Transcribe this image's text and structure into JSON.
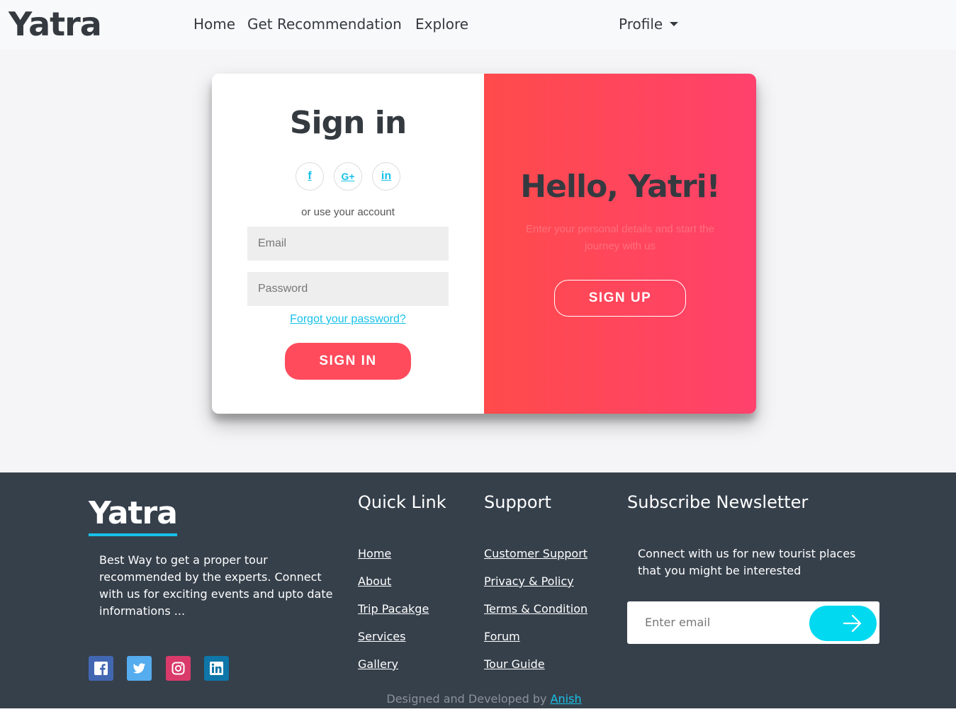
{
  "navbar": {
    "brand": "Yatra",
    "links": {
      "home": "Home",
      "recommendation": "Get Recommendation",
      "explore": "Explore"
    },
    "profile": "Profile"
  },
  "signin": {
    "title": "Sign in",
    "social_icons": [
      "facebook-icon",
      "google-plus-icon",
      "linkedin-icon"
    ],
    "facebook_glyph": "f",
    "google_glyph": "G+",
    "linkedin_glyph": "in",
    "or_text": "or use your account",
    "email_placeholder": "Email",
    "password_placeholder": "Password",
    "forgot": "Forgot your password?",
    "button": "SIGN IN"
  },
  "overlay": {
    "title": "Hello, Yatri!",
    "text": "Enter your personal details and start the journey with us",
    "button": "SIGN UP"
  },
  "footer": {
    "brand": "Yatra",
    "description": "Best Way to get a proper tour recommended by the experts. Connect with us for exciting events and upto date informations ...",
    "social_icons": [
      "facebook-icon",
      "twitter-icon",
      "instagram-icon",
      "linkedin-icon"
    ],
    "quick_link": {
      "title": "Quick Link",
      "items": [
        "Home",
        "About",
        "Trip Pacakge",
        "Services",
        "Gallery"
      ]
    },
    "support": {
      "title": "Support",
      "items": [
        "Customer Support",
        "Privacy & Policy",
        "Terms & Condition",
        "Forum",
        "Tour Guide"
      ]
    },
    "newsletter": {
      "title": "Subscribe Newsletter",
      "text": "Connect with us for new tourist places that you might be interested",
      "placeholder": "Enter email",
      "button_icon": "arrow-right-icon"
    },
    "credit": {
      "prefix": "Designed and Developed by",
      "author": "Anish"
    }
  },
  "colors": {
    "accent": "#ff4b5c",
    "gradient_start": "#ff4b4b",
    "gradient_end": "#ff416c",
    "link": "#17c1e8",
    "footer_bg": "#36404b",
    "newsletter_button": "#00d9ef"
  }
}
